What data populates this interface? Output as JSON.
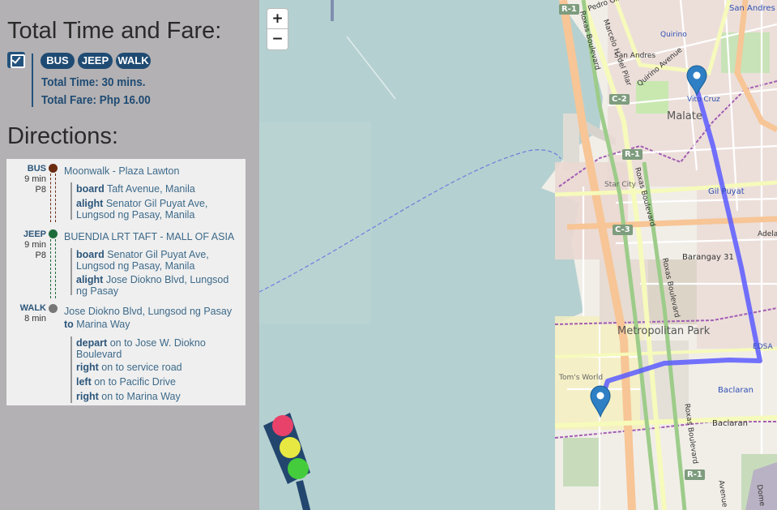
{
  "sidebar": {
    "title": "Total Time and Fare:",
    "modes": [
      "BUS",
      "JEEP",
      "WALK"
    ],
    "total_time": "Total Time: 30 mins.",
    "total_fare": "Total Fare: Php 16.00",
    "directions_title": "Directions:",
    "legs": [
      {
        "mode": "BUS",
        "duration": "9 min",
        "fare": "P8",
        "color": "#6b2c12",
        "title": "Moonwalk - Plaza Lawton",
        "steps": [
          {
            "verb": "board",
            "text": "Taft Avenue, Manila"
          },
          {
            "verb": "alight",
            "text": "Senator Gil Puyat Ave, Lungsod ng Pasay, Manila"
          }
        ]
      },
      {
        "mode": "JEEP",
        "duration": "9 min",
        "fare": "P8",
        "color": "#1e6b3a",
        "title": "BUENDIA LRT TAFT - MALL OF ASIA",
        "steps": [
          {
            "verb": "board",
            "text": "Senator Gil Puyat Ave, Lungsod ng Pasay, Manila"
          },
          {
            "verb": "alight",
            "text": "Jose Diokno Blvd, Lungsod ng Pasay"
          }
        ]
      },
      {
        "mode": "WALK",
        "duration": "8 min",
        "color": "#777777",
        "title": "Jose Diokno Blvd, Lungsod ng Pasay",
        "to_word": "to",
        "to_place": "Marina Way",
        "steps": [
          {
            "verb": "depart",
            "text": "on to Jose W. Diokno Boulevard"
          },
          {
            "verb": "right",
            "text": "on to service road"
          },
          {
            "verb": "left",
            "text": "on to Pacific Drive"
          },
          {
            "verb": "right",
            "text": "on to Marina Way"
          }
        ]
      }
    ]
  },
  "map": {
    "zoom_in": "+",
    "zoom_out": "−",
    "route_color": "#5a5aff",
    "labels": {
      "san_andres": "San Andres",
      "pedro_gil": "Pedro Gil",
      "quirino": "Quirino",
      "quirino_avenue": "Quirino Avenue",
      "san_andres_2": "San Andres",
      "marcelo": "Marcelo H. del Pilar",
      "roxas_blvd_top": "Roxas Boulevard",
      "vito_cruz": "Vito Cruz",
      "malate": "Malate",
      "star_city": "Star City",
      "gil_puyat": "Gil Puyat",
      "adela": "Adela",
      "barangay_31": "Barangay 31",
      "metropolitan_park": "Metropolitan Park",
      "edsa": "EDSA",
      "toms_world": "Tom's World",
      "baclaran": "Baclaran",
      "baclaran_2": "Baclaran",
      "roxas_blvd_mid": "Roxas Boulevard",
      "roxas_blvd_low": "Roxas Boulevard",
      "roxas_blvd_bot": "Roxas Boulevard",
      "avenue": "Avenue",
      "dome": "Dome"
    },
    "shields": {
      "r1_top": "R-1",
      "c2": "C-2",
      "r1_mid": "R-1",
      "c3": "C-3",
      "r1_bot": "R-1"
    }
  }
}
